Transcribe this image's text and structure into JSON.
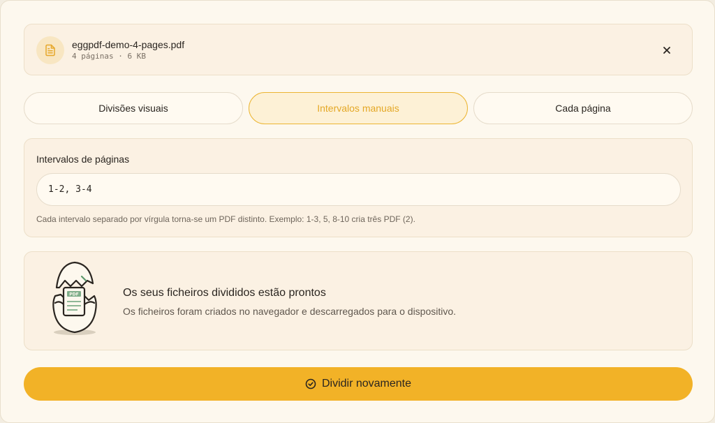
{
  "file": {
    "name": "eggpdf-demo-4-pages.pdf",
    "meta": "4 páginas · 6 KB",
    "icon": "document-icon",
    "close_icon": "close-icon"
  },
  "tabs": [
    {
      "label": "Divisões visuais",
      "active": false
    },
    {
      "label": "Intervalos manuais",
      "active": true
    },
    {
      "label": "Cada página",
      "active": false
    }
  ],
  "ranges": {
    "label": "Intervalos de páginas",
    "value": "1-2, 3-4",
    "help": "Cada intervalo separado por vírgula torna-se um PDF distinto. Exemplo: 1-3, 5, 8-10 cria três PDF (2)."
  },
  "result": {
    "illustration": "egg-pdf-illustration",
    "badge": "PDF",
    "title": "Os seus ficheiros divididos estão prontos",
    "subtitle": "Os ficheiros foram criados no navegador e descarregados para o dispositivo."
  },
  "action": {
    "label": "Dividir novamente",
    "icon": "check-circle-icon"
  },
  "colors": {
    "accent": "#f2b227",
    "accent_text": "#e4a826",
    "background": "#fdf8ee",
    "panel": "#fbf1e3"
  }
}
